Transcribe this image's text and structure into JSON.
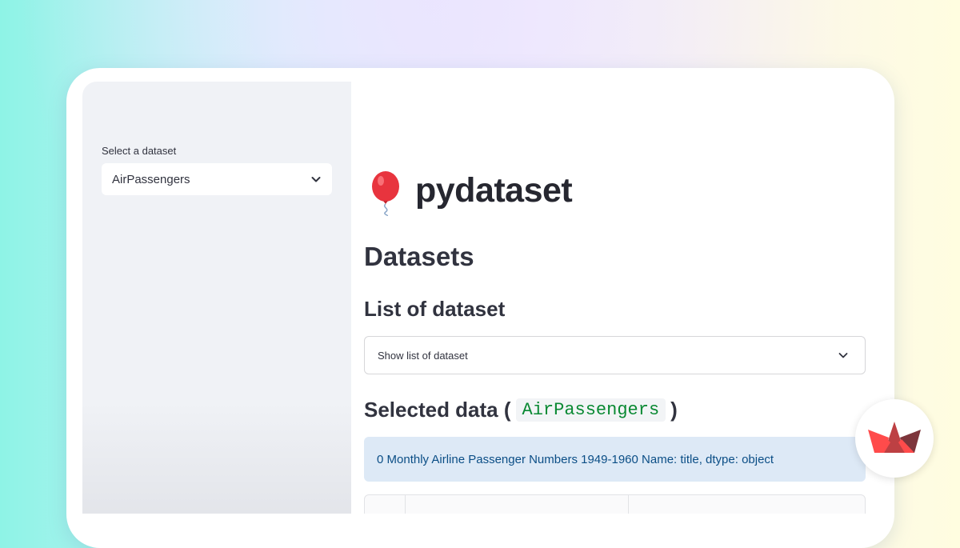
{
  "sidebar": {
    "select_label": "Select a dataset",
    "selected_value": "AirPassengers",
    "chevron_icon": "chevron-down-icon"
  },
  "main": {
    "title_icon": "balloon-icon",
    "title": "pydataset",
    "heading_datasets": "Datasets",
    "heading_list": "List of dataset",
    "expander_label": "Show list of dataset",
    "selected_heading_prefix": "Selected data (",
    "selected_dataset": "AirPassengers",
    "selected_heading_suffix": ")",
    "info_text": "0 Monthly Airline Passenger Numbers 1949-1960 Name: title, dtype: object"
  },
  "badge": {
    "icon": "streamlit-crown-logo"
  },
  "colors": {
    "accent_code": "#098932",
    "info_bg": "#dde9f6",
    "info_text": "#0b4e86",
    "sidebar_bg": "#f0f2f6",
    "balloon": "#e8343e",
    "logo": "#ff4b4b"
  }
}
